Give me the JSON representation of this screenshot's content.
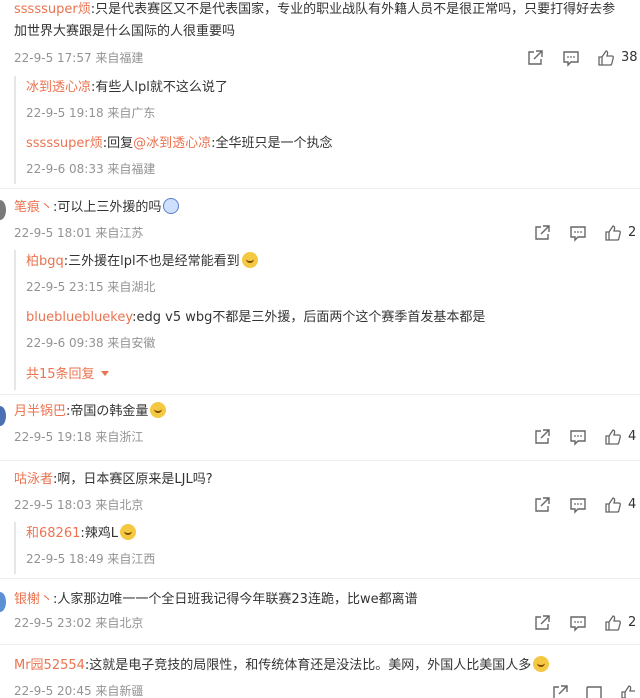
{
  "comments": [
    {
      "user": "sssssuper烦",
      "text_line1": ":只是代表赛区又不是代表国家，专业的职业战队有外籍人员不是很正常吗，只要打得好去参",
      "text_line2": "加世界大赛跟是什么国际的人很重要吗",
      "time": "22-9-5 17:57 来自福建",
      "likes": "38",
      "replies": [
        {
          "user": "冰到透心凉",
          "text": ":有些人lpl就不这么说了",
          "time": "22-9-5 19:18 来自广东"
        },
        {
          "user": "sssssuper烦",
          "text_prefix": ":回复",
          "mention": "@冰到透心凉",
          "text": ":全华班只是一个执念",
          "time": "22-9-6 08:33 来自福建"
        }
      ]
    },
    {
      "user": "笔痕丶",
      "text": ":可以上三外援的吗",
      "time": "22-9-5 18:01 来自江苏",
      "likes": "2",
      "replies": [
        {
          "user": "柏bgq",
          "text": ":三外援在lpl不也是经常能看到",
          "time": "22-9-5 23:15 来自湖北"
        },
        {
          "user": "bluebluebluekey",
          "text": ":edg v5 wbg不都是三外援，后面两个这个赛季首发基本都是",
          "time": "22-9-6 09:38 来自安徽"
        }
      ],
      "more_replies": "共15条回复"
    },
    {
      "user": "月半锅巴",
      "text": ":帝国の韩金量",
      "time": "22-9-5 19:18 来自浙江",
      "likes": "4"
    },
    {
      "user": "咕泳者",
      "text": ":啊，日本赛区原来是LJL吗?",
      "time": "22-9-5 18:03 来自北京",
      "likes": "4",
      "replies": [
        {
          "user": "和68261",
          "text": ":辣鸡L",
          "time": "22-9-5 18:49 来自江西"
        }
      ]
    },
    {
      "user": "银榭丶",
      "text": ":人家那边唯一一个全日班我记得今年联赛23连跪，比we都离谱",
      "time": "22-9-5 23:02 来自北京",
      "likes": "2"
    },
    {
      "user": "Mr园52554",
      "text": ":这就是电子竞技的局限性，和传统体育还是没法比。美网，外国人比美国人多",
      "time": "22-9-5 20:45 来自新疆",
      "likes": ""
    }
  ],
  "colors": {
    "username": "#eb7350",
    "meta": "#939393",
    "text": "#333333"
  },
  "icons": [
    "share-icon",
    "comment-icon",
    "like-icon",
    "caret-down-icon"
  ]
}
